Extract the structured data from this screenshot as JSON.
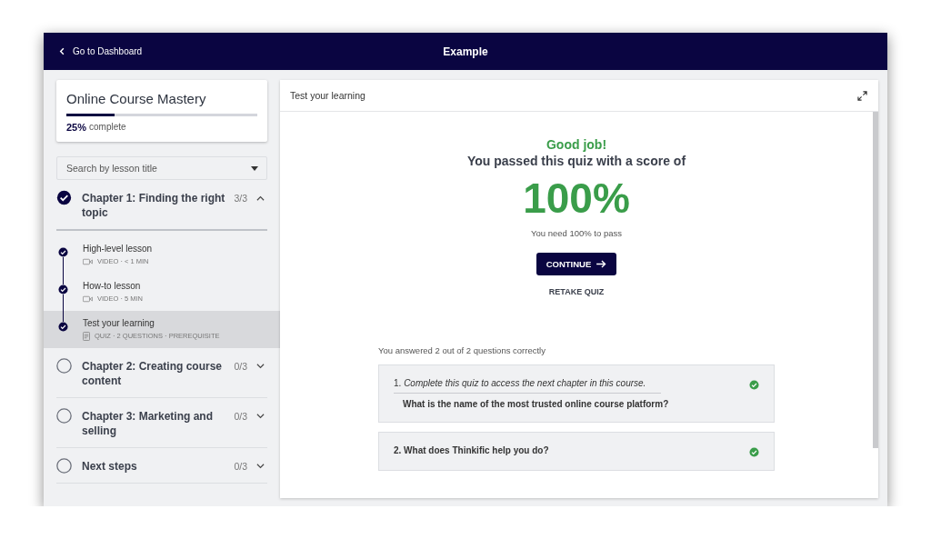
{
  "header": {
    "back_link": "Go to Dashboard",
    "title": "Example"
  },
  "course": {
    "title": "Online Course Mastery",
    "progress": {
      "level": 0.25,
      "percent": "25%",
      "label": "complete"
    }
  },
  "search": {
    "placeholder": "Search by lesson title"
  },
  "chapters": [
    {
      "title": "Chapter 1: Finding the right topic",
      "count": "3/3",
      "completed": true,
      "expanded": true,
      "lessons": [
        {
          "title": "High-level lesson",
          "kind": "video",
          "meta": "VIDEO · < 1 MIN",
          "completed": true,
          "selected": false
        },
        {
          "title": "How-to lesson",
          "kind": "video",
          "meta": "VIDEO · 5 MIN",
          "completed": true,
          "selected": false
        },
        {
          "title": "Test your learning",
          "kind": "quiz",
          "meta": "QUIZ · 2 QUESTIONS · PREREQUISITE",
          "completed": true,
          "selected": true
        }
      ]
    },
    {
      "title": "Chapter 2: Creating course content",
      "count": "0/3",
      "completed": false,
      "expanded": false
    },
    {
      "title": "Chapter 3: Marketing and selling",
      "count": "0/3",
      "completed": false,
      "expanded": false
    },
    {
      "title": "Next steps",
      "count": "0/3",
      "completed": false,
      "expanded": false
    }
  ],
  "content": {
    "title": "Test your learning",
    "result": {
      "heading": "Good job!",
      "subheading": "You passed this quiz with a score of",
      "score": "100%",
      "requirement": "You need 100% to pass",
      "continue_button": "CONTINUE",
      "retake_link": "RETAKE QUIZ"
    },
    "summary": "You answered 2 out of 2 questions correctly",
    "questions": [
      {
        "intro": "1. *Complete this quiz to access the next chapter in this course.*",
        "text": "What is the name of the most trusted online course platform?",
        "correct": true
      },
      {
        "text": "2. What does Thinkific help you do?",
        "correct": true
      }
    ]
  }
}
